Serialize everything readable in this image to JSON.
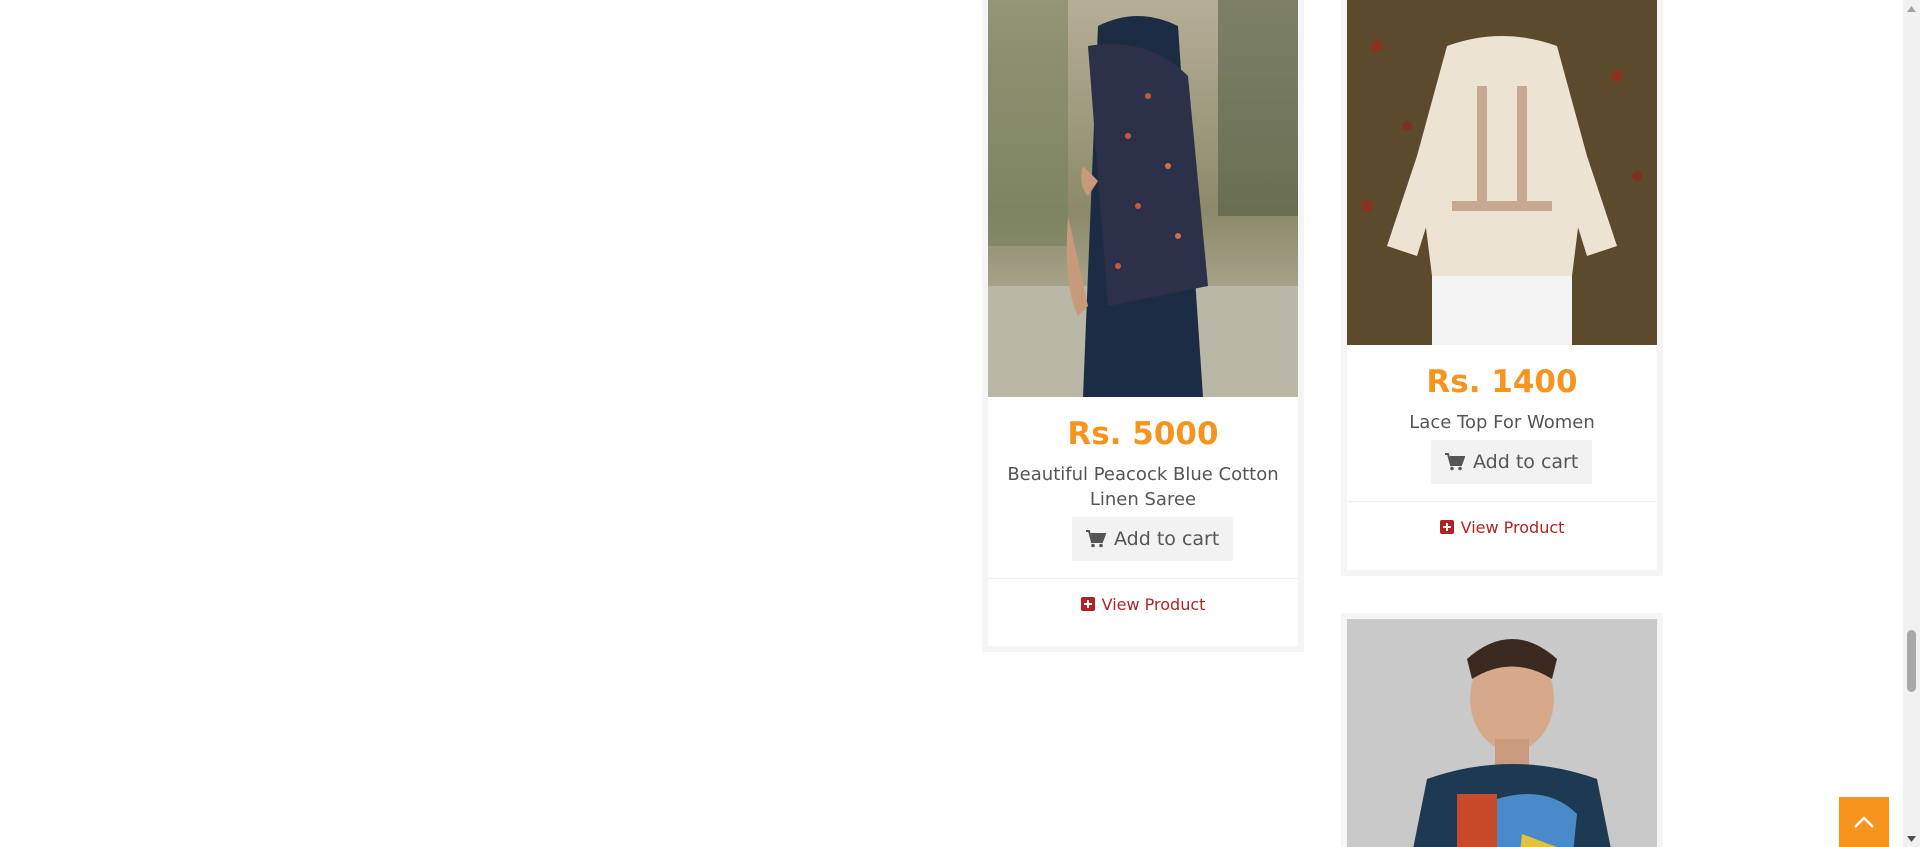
{
  "products": [
    {
      "price": "Rs. 5000",
      "title": "Beautiful Peacock Blue Cotton Linen Saree",
      "cart_label": "Add to cart",
      "view_label": "View Product"
    },
    {
      "price": "Rs. 1400",
      "title": "Lace Top For Women",
      "cart_label": "Add to cart",
      "view_label": "View Product"
    }
  ],
  "colors": {
    "price": "#f7941d",
    "link": "#b22222",
    "scroll_top_button": "#f7941d"
  },
  "icons": {
    "cart": "shopping-cart-icon",
    "view": "plus-square-icon",
    "scroll_top": "chevron-up-icon"
  }
}
